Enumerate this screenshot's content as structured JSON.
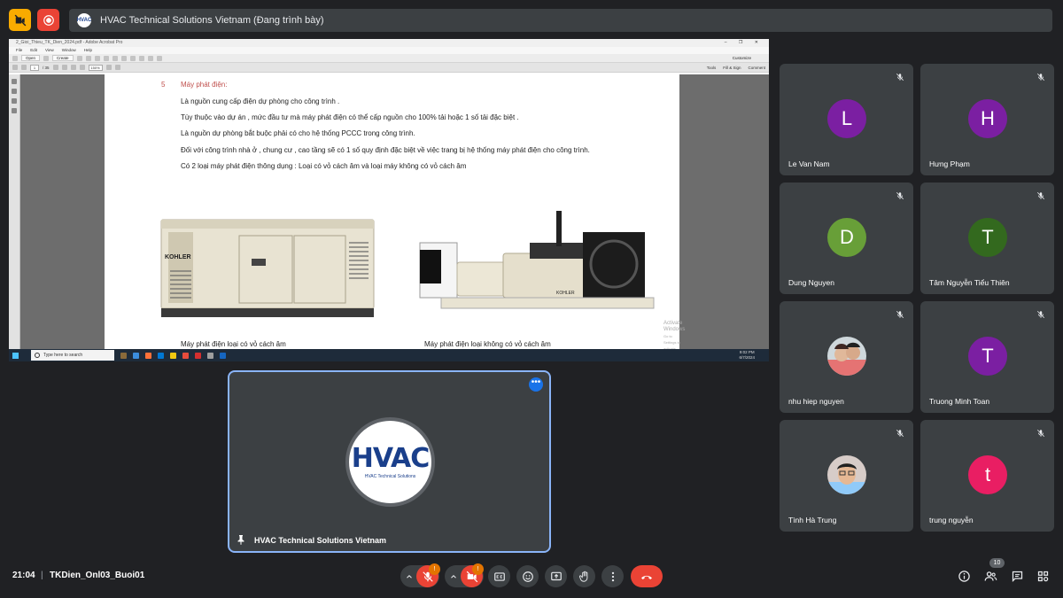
{
  "top_bar": {
    "camera_status_icon": "video-off-icon",
    "recording_icon": "record-icon",
    "presenter_logo_text": "HVAC",
    "presentation_title": "HVAC Technical Solutions Vietnam (Đang trình bày)"
  },
  "shared_screen": {
    "window_title": "2_Gioi_Thieu_TK_Dien_2024.pdf - Adobe Acrobat Pro",
    "menu": [
      "File",
      "Edit",
      "View",
      "Window",
      "Help"
    ],
    "toolbar": {
      "open": "Open",
      "create": "Create",
      "page_current": "1",
      "page_total": "/ 35",
      "zoom": "150%",
      "customize": "Customize"
    },
    "right_tools": [
      "Tools",
      "Fill & Sign",
      "Comment"
    ],
    "document": {
      "section_number": "5",
      "section_title": "Máy phát điện:",
      "paragraphs": [
        "Là nguồn cung cấp điện dự phòng cho công trình .",
        "Tùy thuộc vào dự án , mức đầu tư mà máy phát điện có thể cấp nguồn cho 100% tải hoặc 1 số tải đặc biệt .",
        "Là nguồn dự phòng bắt buộc phải có cho hệ thống PCCC trong công trình.",
        "Đối với công trình nhà ở , chung cư , cao tầng sẽ có 1 số quy định đặc biệt về việc trang bị hệ thống máy phát điện cho công trình.",
        "Có 2 loại máy phát điện thông dụng : Loại có vỏ cách âm và loại máy không có vỏ cách âm"
      ],
      "image_captions": [
        "Máy phát điện loại có vỏ cách âm",
        "Máy phát điện loại không có vỏ cách âm"
      ],
      "generator_brand": "KOHLER",
      "watermark_lines": [
        "Activate Windows",
        "Go to Settings to activate Windows."
      ]
    },
    "taskbar": {
      "search_placeholder": "Type here to search",
      "clock_time": "9:02 PM",
      "clock_date": "6/7/2024"
    }
  },
  "presenter_tile": {
    "logo_main": "HVAC",
    "logo_sub": "HVAC Technical Solutions",
    "name": "HVAC Technical Solutions Vietnam",
    "more_label": "•••",
    "pin_icon": "pin-icon"
  },
  "participants": [
    {
      "name": "Le Van Nam",
      "initial": "L",
      "color": "#7b1fa2",
      "muted": true
    },
    {
      "name": "Hưng Phạm",
      "initial": "H",
      "color": "#7b1fa2",
      "muted": true
    },
    {
      "name": "Dung Nguyen",
      "initial": "D",
      "color": "#689f38",
      "muted": true
    },
    {
      "name": "Tâm Nguyễn Tiểu Thiên",
      "initial": "T",
      "color": "#33691e",
      "muted": true
    },
    {
      "name": "nhu hiep nguyen",
      "initial": "",
      "color": "#d9d9d9",
      "muted": true,
      "photo": true
    },
    {
      "name": "Truong Minh Toan",
      "initial": "T",
      "color": "#7b1fa2",
      "muted": true
    },
    {
      "name": "Tình Hà Trung",
      "initial": "",
      "color": "#d9d9d9",
      "muted": true,
      "photo": true
    },
    {
      "name": "trung nguyễn",
      "initial": "t",
      "color": "#e91e63",
      "muted": true
    }
  ],
  "bottom_bar": {
    "time": "21:04",
    "separator": "|",
    "meeting_name": "TKDien_Onl03_Buoi01",
    "mic_badge": "!",
    "camera_badge": "!",
    "people_count": "10",
    "controls": [
      "mic-off-icon",
      "video-off-icon",
      "captions-icon",
      "emoji-icon",
      "present-icon",
      "raise-hand-icon",
      "more-icon",
      "leave-call-icon"
    ],
    "right_controls": [
      "info-icon",
      "people-icon",
      "chat-icon",
      "activities-icon"
    ]
  }
}
